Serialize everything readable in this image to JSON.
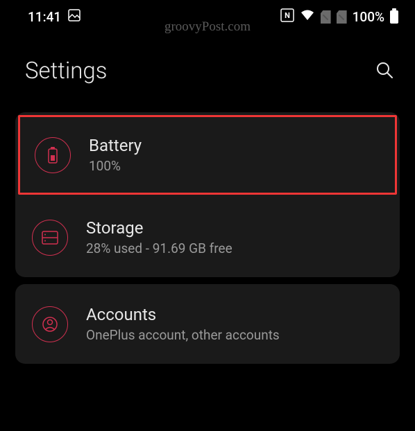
{
  "statusBar": {
    "time": "11:41",
    "battery": "100%"
  },
  "watermark": "groovyPost.com",
  "header": {
    "title": "Settings"
  },
  "cards": [
    {
      "items": [
        {
          "title": "Battery",
          "subtitle": "100%",
          "icon": "battery",
          "highlighted": true
        },
        {
          "title": "Storage",
          "subtitle": "28% used - 91.69 GB free",
          "icon": "storage",
          "highlighted": false
        }
      ]
    },
    {
      "items": [
        {
          "title": "Accounts",
          "subtitle": "OnePlus account, other accounts",
          "icon": "accounts",
          "highlighted": false
        }
      ]
    }
  ]
}
